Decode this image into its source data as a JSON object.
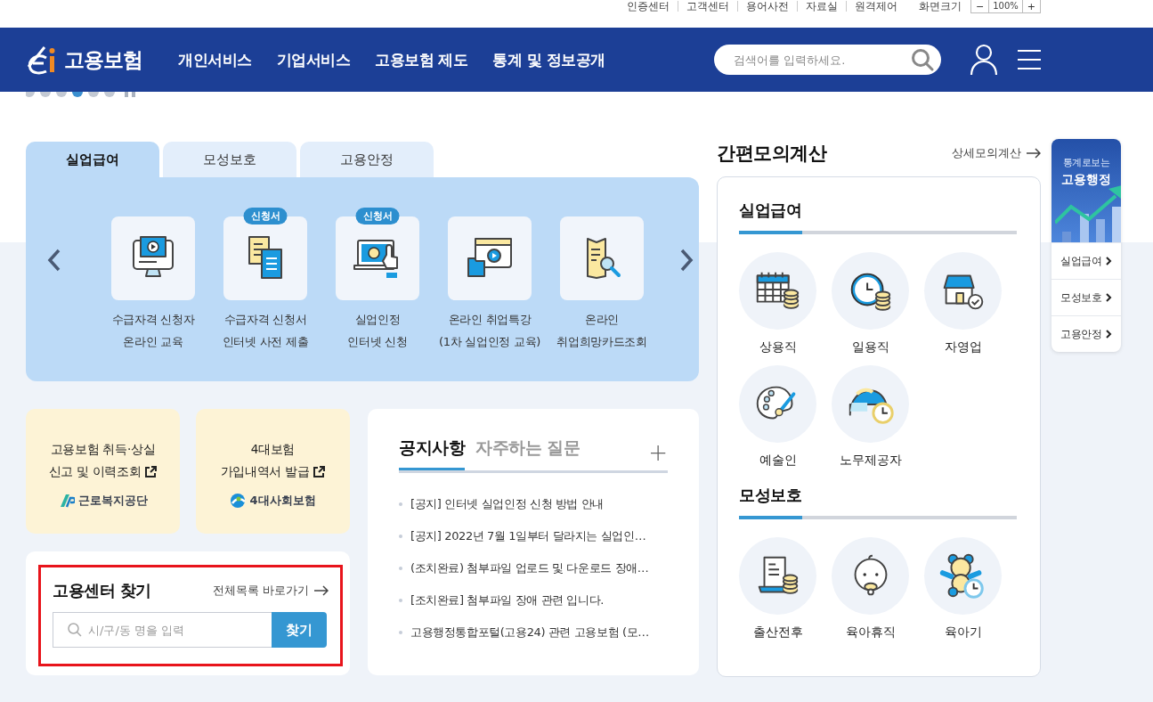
{
  "utility_links": [
    "인증센터",
    "고객센터",
    "용어사전",
    "자료실",
    "원격제어"
  ],
  "font_size": {
    "label": "화면크기",
    "minus": "−",
    "value": "100%",
    "plus": "+"
  },
  "header": {
    "logo_text": "고용보험",
    "nav": [
      "개인서비스",
      "기업서비스",
      "고용보험 제도",
      "통계 및 정보공개"
    ],
    "search": {
      "placeholder": "검색어를 입력하세요."
    }
  },
  "service_tabs": [
    {
      "label": "실업급여",
      "selected": true
    },
    {
      "label": "모성보호",
      "selected": false
    },
    {
      "label": "고용안정",
      "selected": false
    }
  ],
  "services": [
    {
      "lines": [
        "수급자격 신청자",
        "온라인 교육"
      ]
    },
    {
      "lines": [
        "수급자격 신청서",
        "인터넷 사전 제출"
      ],
      "badge": "신청서"
    },
    {
      "lines": [
        "실업인정",
        "인터넷 신청"
      ],
      "badge": "신청서"
    },
    {
      "lines": [
        "온라인 취업특강",
        "(1차 실업인정 교육)"
      ]
    },
    {
      "lines": [
        "온라인",
        "취업희망카드조회"
      ]
    }
  ],
  "link_cards": [
    {
      "lines": [
        "고용보험 취득·상실",
        "신고 및 이력조회"
      ],
      "org": "근로복지공단"
    },
    {
      "lines": [
        "4대보험",
        "가입내역서 발급"
      ],
      "org": "4대사회보험"
    }
  ],
  "center_search": {
    "title": "고용센터 찾기",
    "link": "전체목록 바로가기",
    "placeholder": "시/구/동 명을 입력",
    "button": "찾기",
    "highlighted": true
  },
  "notice": {
    "tabs": [
      {
        "label": "공지사항",
        "selected": true
      },
      {
        "label": "자주하는 질문",
        "selected": false
      }
    ],
    "more": "+",
    "items": [
      "[공지] 인터넷 실업인정 신청 방법 안내",
      "[공지] 2022년 7월 1일부터 달라지는 실업인…",
      "(조치완료) 첨부파일 업로드 및 다운로드 장애…",
      "[조치완료] 첨부파일 장애 관련 입니다.",
      "고용행정통합포털(고용24) 관련 고용보험 (모…"
    ]
  },
  "calculator": {
    "title": "간편모의계산",
    "link": "상세모의계산",
    "sections": [
      {
        "title": "실업급여",
        "items": [
          "상용직",
          "일용직",
          "자영업",
          "예술인",
          "노무제공자"
        ]
      },
      {
        "title": "모성보호",
        "items": [
          "출산전후",
          "육아휴직",
          "육아기"
        ]
      }
    ]
  },
  "stats_widget": {
    "caption": "통계로보는",
    "title": "고용행정",
    "links": [
      "실업급여",
      "모성보호",
      "고용안정"
    ]
  }
}
